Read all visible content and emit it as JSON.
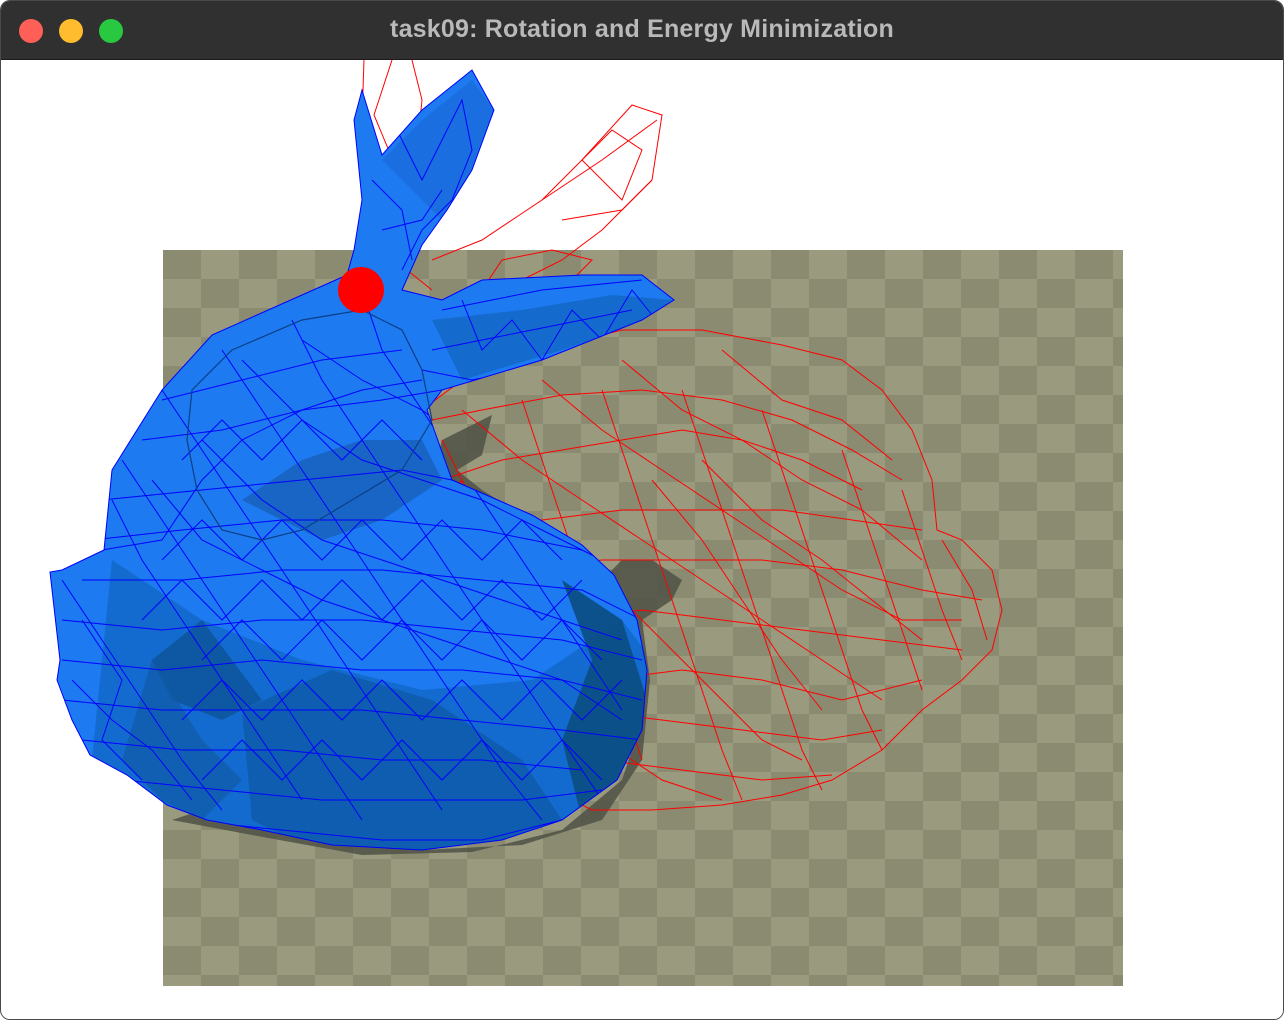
{
  "window": {
    "title": "task09: Rotation and Energy Minimization",
    "controls": [
      "close",
      "minimize",
      "zoom"
    ]
  },
  "scene": {
    "background_color": "#ffffff",
    "floor": {
      "color_dark": "#8b8b72",
      "color_light": "#9a9a7f"
    },
    "bunny_solid": {
      "fill": "#1a6fe8",
      "shade": "#0d4f8c",
      "edge": "#0000ff"
    },
    "bunny_wire": {
      "edge": "#ff0000"
    },
    "handle_point": {
      "color": "#ff0000",
      "icon": "handle-dot"
    }
  }
}
